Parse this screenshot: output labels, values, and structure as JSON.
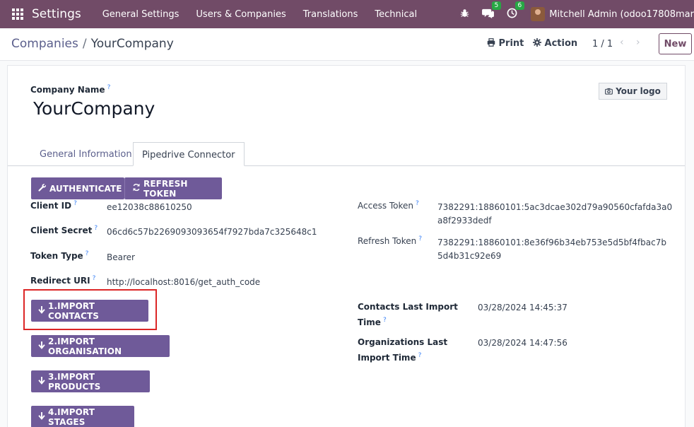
{
  "navbar": {
    "brand": "Settings",
    "menu": [
      "General Settings",
      "Users & Companies",
      "Translations",
      "Technical"
    ],
    "bug_icon": "bug-icon",
    "chat_badge": "5",
    "activity_badge": "6",
    "user": "Mitchell Admin (odoo17808mar"
  },
  "control": {
    "breadcrumb_parent": "Companies",
    "breadcrumb_sep": "/",
    "breadcrumb_current": "YourCompany",
    "print_label": "Print",
    "action_label": "Action",
    "pager": "1 / 1",
    "new_label": "New"
  },
  "form": {
    "company_name_label": "Company Name",
    "company_name": "YourCompany",
    "logo_label": "Your logo",
    "tabs": [
      "General Information",
      "Pipedrive Connector"
    ],
    "authenticate_label": "AUTHENTICATE",
    "refresh_token_btn_label": "REFRESH TOKEN",
    "client_id_label": "Client ID",
    "client_id": "ee12038c88610250",
    "client_secret_label": "Client Secret",
    "client_secret": "06cd6c57b2269093093654f7927bda7c325648c1",
    "token_type_label": "Token Type",
    "token_type": "Bearer",
    "redirect_uri_label": "Redirect URI",
    "redirect_uri": "http://localhost:8016/get_auth_code",
    "access_token_label": "Access Token",
    "access_token_line1": "7382291:18860101:5ac3dcae302d79a90560cfafda3a0",
    "access_token_line2": "a8f2933dedf",
    "refresh_token_label": "Refresh Token",
    "refresh_token_line1": "7382291:18860101:8e36f96b34eb753e5d5bf4fbac7b",
    "refresh_token_line2": "5d4b31c92e69",
    "import_contacts": "1.IMPORT CONTACTS",
    "import_organisation": "2.IMPORT ORGANISATION",
    "import_products": "3.IMPORT PRODUCTS",
    "import_stages": "4.IMPORT STAGES",
    "contacts_last_import_label_1": "Contacts Last Import",
    "contacts_last_import_label_2": "Time",
    "contacts_last_import": "03/28/2024 14:45:37",
    "org_last_import_label_1": "Organizations Last",
    "org_last_import_label_2": "Import Time",
    "org_last_import": "03/28/2024 14:47:56",
    "help_mark": "?"
  },
  "colors": {
    "navbar": "#714b67",
    "primary_button": "#6f5a99",
    "highlight": "#dc2626"
  }
}
